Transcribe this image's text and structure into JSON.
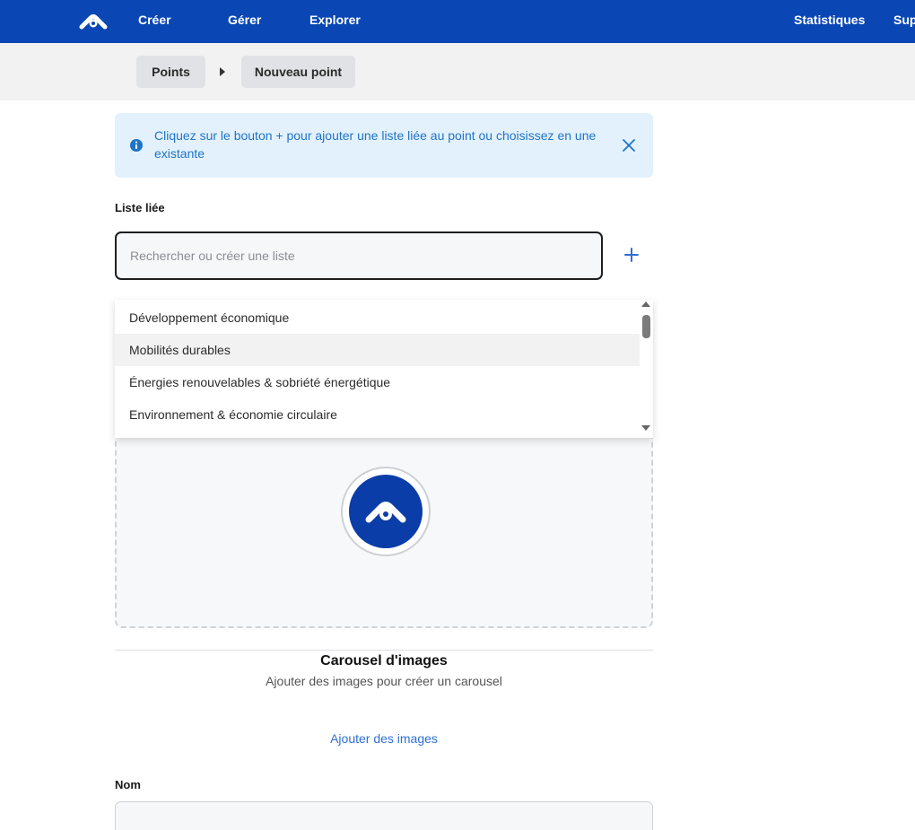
{
  "nav": {
    "items": [
      {
        "label": "Créer"
      },
      {
        "label": "Gérer"
      },
      {
        "label": "Explorer"
      },
      {
        "label": "Statistiques"
      },
      {
        "label": "Sup"
      }
    ]
  },
  "breadcrumb": {
    "items": [
      {
        "label": "Points"
      },
      {
        "label": "Nouveau point"
      }
    ]
  },
  "alert": {
    "text": "Cliquez sur le bouton + pour ajouter une liste liée au point ou choisissez en une existante",
    "color": "#1e74c7",
    "background": "#e3f1fd"
  },
  "linked_list": {
    "label": "Liste liée",
    "placeholder": "Rechercher ou créer une liste",
    "value": ""
  },
  "dropdown": {
    "options": [
      {
        "label": "Développement économique"
      },
      {
        "label": "Mobilités durables",
        "highlighted": true
      },
      {
        "label": "Énergies renouvelables & sobriété énergétique"
      },
      {
        "label": "Environnement & économie circulaire"
      }
    ]
  },
  "carousel": {
    "title": "Carousel d'images",
    "subtitle": "Ajouter des images pour créer un carousel",
    "add_link": "Ajouter des images"
  },
  "name_field": {
    "label": "Nom",
    "value": ""
  },
  "colors": {
    "brand": "#0a47b5",
    "link": "#2f6fd6"
  },
  "icons": {
    "logo": "brand-logo-icon",
    "info": "info-icon",
    "close": "close-icon",
    "add": "plus-icon",
    "separator": "caret-right-icon"
  }
}
